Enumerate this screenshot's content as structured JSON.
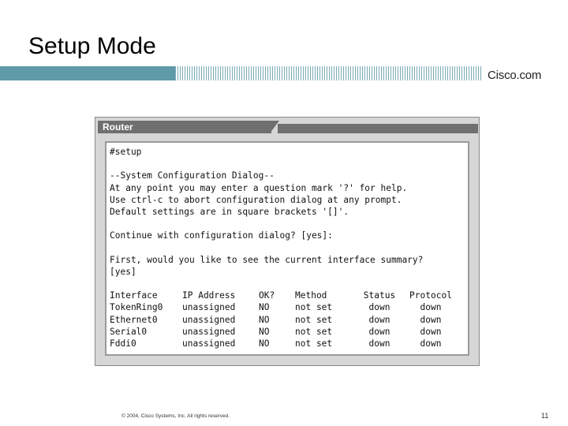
{
  "slide": {
    "title": "Setup Mode",
    "logo_text": "Cisco.com",
    "footer": "© 2004, Cisco Systems, Inc. All rights reserved.",
    "page_number": "11"
  },
  "window": {
    "title": "Router"
  },
  "terminal": {
    "prompt": "#setup",
    "dialog_lines": [
      "--System Configuration Dialog--",
      "At any point you may enter a question mark '?' for help.",
      "Use ctrl-c to abort configuration dialog at any prompt.",
      "Default settings are in square brackets '[]'."
    ],
    "continue_line": "Continue with configuration dialog? [yes]:",
    "summary_lines": [
      "First, would you like to see the current interface summary?",
      "[yes]"
    ],
    "table": {
      "headers": [
        "Interface",
        "IP Address",
        "OK?",
        "Method",
        "Status",
        "Protocol"
      ],
      "rows": [
        [
          "TokenRing0",
          "unassigned",
          "NO",
          "not set",
          "down",
          "down"
        ],
        [
          "Ethernet0",
          "unassigned",
          "NO",
          "not set",
          "down",
          "down"
        ],
        [
          "Serial0",
          "unassigned",
          "NO",
          "not set",
          "down",
          "down"
        ],
        [
          "Fddi0",
          "unassigned",
          "NO",
          "not set",
          "down",
          "down"
        ]
      ]
    }
  },
  "colors": {
    "band": "#5f9aa8",
    "titlebar": "#6f6f6f",
    "window_bg": "#d6d6d6"
  }
}
